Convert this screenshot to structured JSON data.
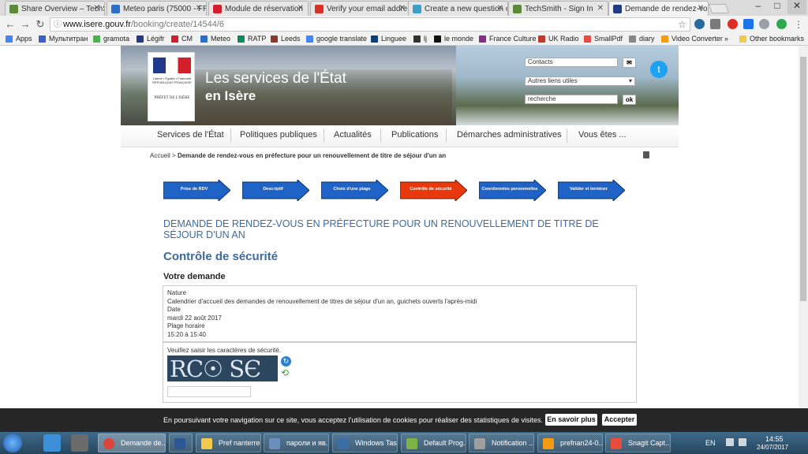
{
  "browser": {
    "tabs": [
      {
        "label": "Share Overview – TechS",
        "favicon": "techsmith-icon",
        "color": "#5a8a3a"
      },
      {
        "label": "Meteo paris (75000 - FR",
        "favicon": "meteo-icon",
        "color": "#2a6fc9"
      },
      {
        "label": "Module de réservation",
        "favicon": "gov-icon",
        "color": "#d21f2b"
      },
      {
        "label": "Verify your email addre",
        "favicon": "gmail-icon",
        "color": "#d93025"
      },
      {
        "label": "Create a new question o",
        "favicon": "superuser-icon",
        "color": "#3aa0c9"
      },
      {
        "label": "TechSmith - Sign In",
        "favicon": "techsmith-icon",
        "color": "#5a8a3a"
      },
      {
        "label": "Demande de rendez-vous",
        "favicon": "gov-icon",
        "color": "#1f3a8a",
        "active": true
      }
    ],
    "url": "www.isere.gouv.fr/booking/create/14544/6",
    "url_domain": "www.isere.gouv.fr",
    "url_path": "/booking/create/14544/6",
    "bookmarks": [
      {
        "label": "Apps",
        "color": "#4285f4"
      },
      {
        "label": "Мультитран",
        "color": "#3a5fcd"
      },
      {
        "label": "gramota",
        "color": "#4caf50"
      },
      {
        "label": "Légifr",
        "color": "#1f3a8a"
      },
      {
        "label": "CM",
        "color": "#d21f2b"
      },
      {
        "label": "Meteo",
        "color": "#2a6fc9"
      },
      {
        "label": "RATP",
        "color": "#0c8a5a"
      },
      {
        "label": "Leeds",
        "color": "#8b3a2a"
      },
      {
        "label": "google translate",
        "color": "#4285f4"
      },
      {
        "label": "Linguee",
        "color": "#0a3f7a"
      },
      {
        "label": "lj",
        "color": "#333"
      },
      {
        "label": "le monde",
        "color": "#111"
      },
      {
        "label": "France Culture",
        "color": "#8a2a8a"
      },
      {
        "label": "UK Radio",
        "color": "#c0392b"
      },
      {
        "label": "SmallPdf",
        "color": "#e74c3c"
      },
      {
        "label": "diary",
        "color": "#888"
      },
      {
        "label": "Video Converter",
        "color": "#f39c12"
      }
    ],
    "bookmarks_more": "»",
    "other_bookmarks": "Other bookmarks",
    "apps_label": "Apps"
  },
  "header": {
    "logo_rf": "Liberté • Égalité • Fraternité RÉPUBLIQUE FRANÇAISE",
    "logo_pref": "PRÉFET DE L'ISÈRE",
    "title_line1": "Les services de l'État",
    "title_line2": "en Isère",
    "contacts_value": "Contacts",
    "other_links_value": "Autres liens utiles",
    "search_value": "recherche",
    "ok_label": "ok",
    "twitter_glyph": "t"
  },
  "nav": {
    "items": [
      "Services de l'État",
      "Politiques publiques",
      "Actualités",
      "Publications",
      "Démarches administratives",
      "Vous êtes ..."
    ]
  },
  "breadcrumb": {
    "home": "Accueil",
    "separator": ">",
    "current": "Demande de rendez-vous en préfecture pour un renouvellement de titre de séjour d'un an"
  },
  "steps": [
    {
      "label": "Prise de RDV",
      "color": "#1f63c6"
    },
    {
      "label": "Descriptif",
      "color": "#1f63c6"
    },
    {
      "label": "Choix d'une plage",
      "color": "#1f63c6"
    },
    {
      "label": "Contrôle de sécurité",
      "color": "#e8390e",
      "active": true
    },
    {
      "label": "Coordonnées personnelles",
      "color": "#1f63c6"
    },
    {
      "label": "Valider et terminer",
      "color": "#1f63c6"
    }
  ],
  "content": {
    "main_heading": "DEMANDE DE RENDEZ-VOUS EN PRÉFECTURE POUR UN RENOUVELLEMENT DE TITRE DE SÉJOUR D'UN AN",
    "section_title": "Contrôle de sécurité",
    "request_title": "Votre demande",
    "request": {
      "nature_label": "Nature",
      "nature_value": "Calendrier d'accueil des demandes de renouvellement de titres de séjour d'un an, guichets ouverts l'après-midi",
      "date_label": "Date",
      "date_value": "mardi 22 août 2017",
      "slot_label": "Plage horaire",
      "slot_value": "15:20 à 15:40"
    },
    "captcha": {
      "label": "Veuillez saisir les caractères de sécurité.",
      "image_text": "RC☉ SЄ",
      "input_value": ""
    }
  },
  "cookie": {
    "text": "En poursuivant votre navigation sur ce site, vous acceptez l'utilisation de cookies pour réaliser des statistiques de visites.",
    "more_label": "En savoir plus",
    "accept_label": "Accepter"
  },
  "taskbar": {
    "items": [
      {
        "label": "Demande de...",
        "color": "#db4437"
      },
      {
        "label": "",
        "color": "#2b5797"
      },
      {
        "label": "Pref nanterre",
        "color": "#f2c94c"
      },
      {
        "label": "пароли и яв...",
        "color": "#6a8fbf"
      },
      {
        "label": "Windows Tas...",
        "color": "#3a6ea5"
      },
      {
        "label": "Default Prog...",
        "color": "#7cb342"
      },
      {
        "label": "Notification ...",
        "color": "#9e9e9e"
      },
      {
        "label": "prefnan24-0...",
        "color": "#f39c12"
      },
      {
        "label": "Snagit Capt...",
        "color": "#e74c3c"
      }
    ],
    "lang": "EN",
    "time": "14:55",
    "date": "24/07/2017"
  }
}
